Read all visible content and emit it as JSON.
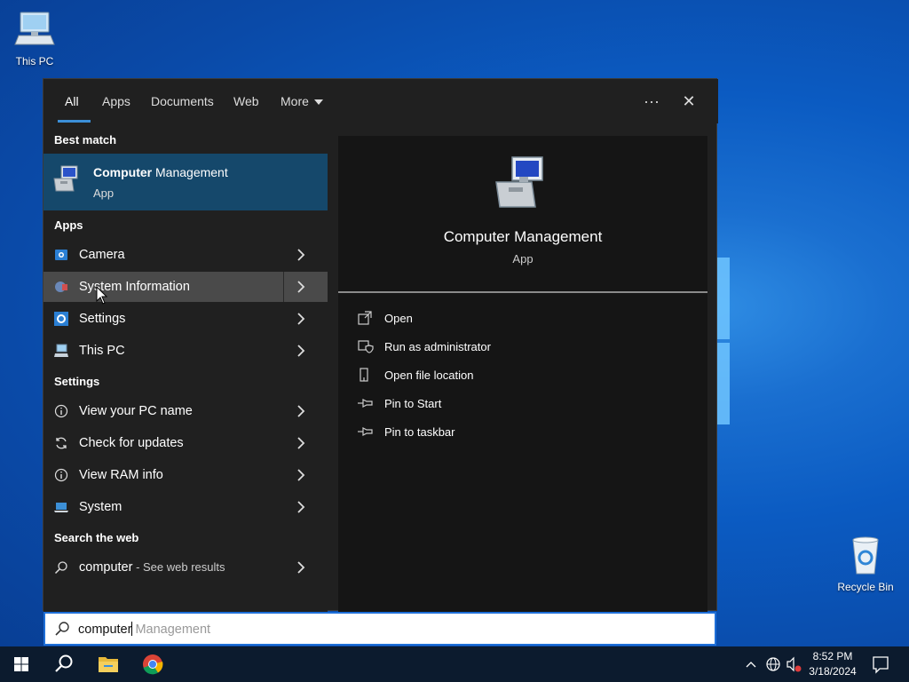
{
  "desktop": {
    "icons": [
      {
        "label": "This PC"
      },
      {
        "label": "Recycle Bin"
      }
    ]
  },
  "search_panel": {
    "tabs": [
      {
        "label": "All"
      },
      {
        "label": "Apps"
      },
      {
        "label": "Documents"
      },
      {
        "label": "Web"
      },
      {
        "label": "More"
      }
    ],
    "more_options": "···",
    "close": "✕",
    "best_match_heading": "Best match",
    "best_match": {
      "title_bold": "Computer",
      "title_rest": " Management",
      "subtitle": "App"
    },
    "apps_heading": "Apps",
    "apps": [
      {
        "label": "Camera"
      },
      {
        "label": "System Information"
      },
      {
        "label": "Settings"
      },
      {
        "label": "This PC"
      }
    ],
    "settings_heading": "Settings",
    "settings": [
      {
        "label": "View your PC name"
      },
      {
        "label": "Check for updates"
      },
      {
        "label": "View RAM info"
      },
      {
        "label": "System"
      }
    ],
    "web_heading": "Search the web",
    "web": {
      "query": "computer",
      "suffix": " - See web results"
    },
    "preview": {
      "title": "Computer Management",
      "subtitle": "App",
      "actions": [
        {
          "label": "Open"
        },
        {
          "label": "Run as administrator"
        },
        {
          "label": "Open file location"
        },
        {
          "label": "Pin to Start"
        },
        {
          "label": "Pin to taskbar"
        }
      ]
    }
  },
  "search_box": {
    "typed": "computer",
    "suggestion": "Management"
  },
  "taskbar": {
    "time": "8:52 PM",
    "date": "3/18/2024"
  },
  "colors": {
    "accent": "#3b8fd8",
    "best_match_bg": "#15486b",
    "panel_bg": "#202020",
    "preview_bg": "#151515"
  }
}
